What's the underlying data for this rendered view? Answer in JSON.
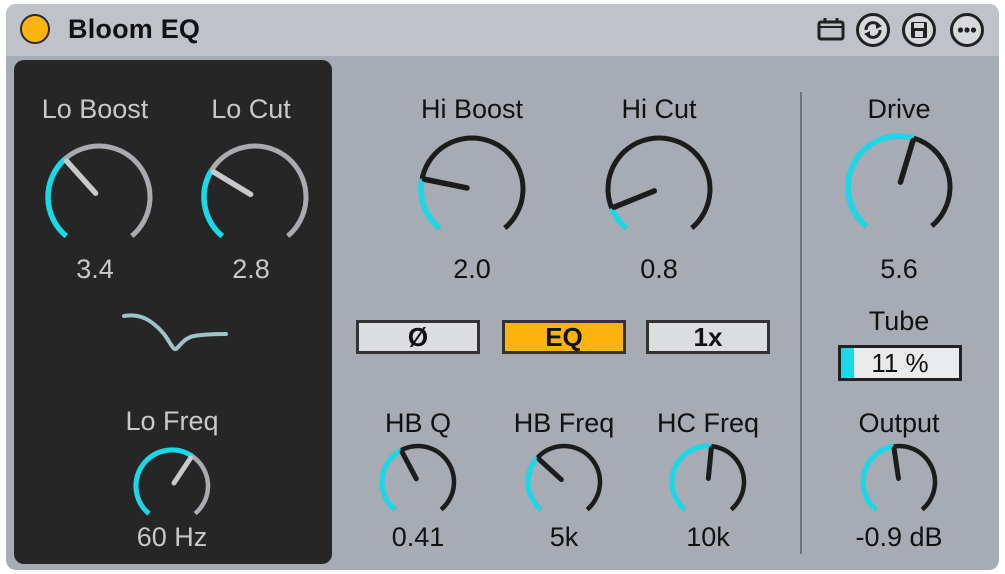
{
  "device": {
    "title": "Bloom EQ",
    "power_color": "#fdb40e",
    "accent_color": "#1bd8e8",
    "header_icons": [
      "pin-icon",
      "hot-swap-icon",
      "save-preset-icon",
      "more-options-icon"
    ]
  },
  "lo_section": {
    "lo_boost": {
      "label": "Lo Boost",
      "value": "3.4",
      "level": 0.35
    },
    "lo_cut": {
      "label": "Lo Cut",
      "value": "2.8",
      "level": 0.29
    },
    "lo_freq": {
      "label": "Lo Freq",
      "value": "60 Hz",
      "level": 0.62
    }
  },
  "hi_section": {
    "hi_boost": {
      "label": "Hi Boost",
      "value": "2.0",
      "level": 0.22
    },
    "hi_cut": {
      "label": "Hi Cut",
      "value": "0.8",
      "level": 0.1
    },
    "hb_q": {
      "label": "HB Q",
      "value": "0.41",
      "level": 0.4
    },
    "hb_freq": {
      "label": "HB Freq",
      "value": "5k",
      "level": 0.33
    },
    "hc_freq": {
      "label": "HC Freq",
      "value": "10k",
      "level": 0.52
    }
  },
  "buttons": {
    "phase": {
      "label": "Ø",
      "active": false
    },
    "eq": {
      "label": "EQ",
      "active": true
    },
    "oversample": {
      "label": "1x",
      "active": false
    }
  },
  "out_section": {
    "drive": {
      "label": "Drive",
      "value": "5.6",
      "level": 0.56
    },
    "tube": {
      "label": "Tube",
      "value": "11 %",
      "level": 0.11
    },
    "output": {
      "label": "Output",
      "value": "-0.9 dB",
      "level": 0.47
    }
  }
}
